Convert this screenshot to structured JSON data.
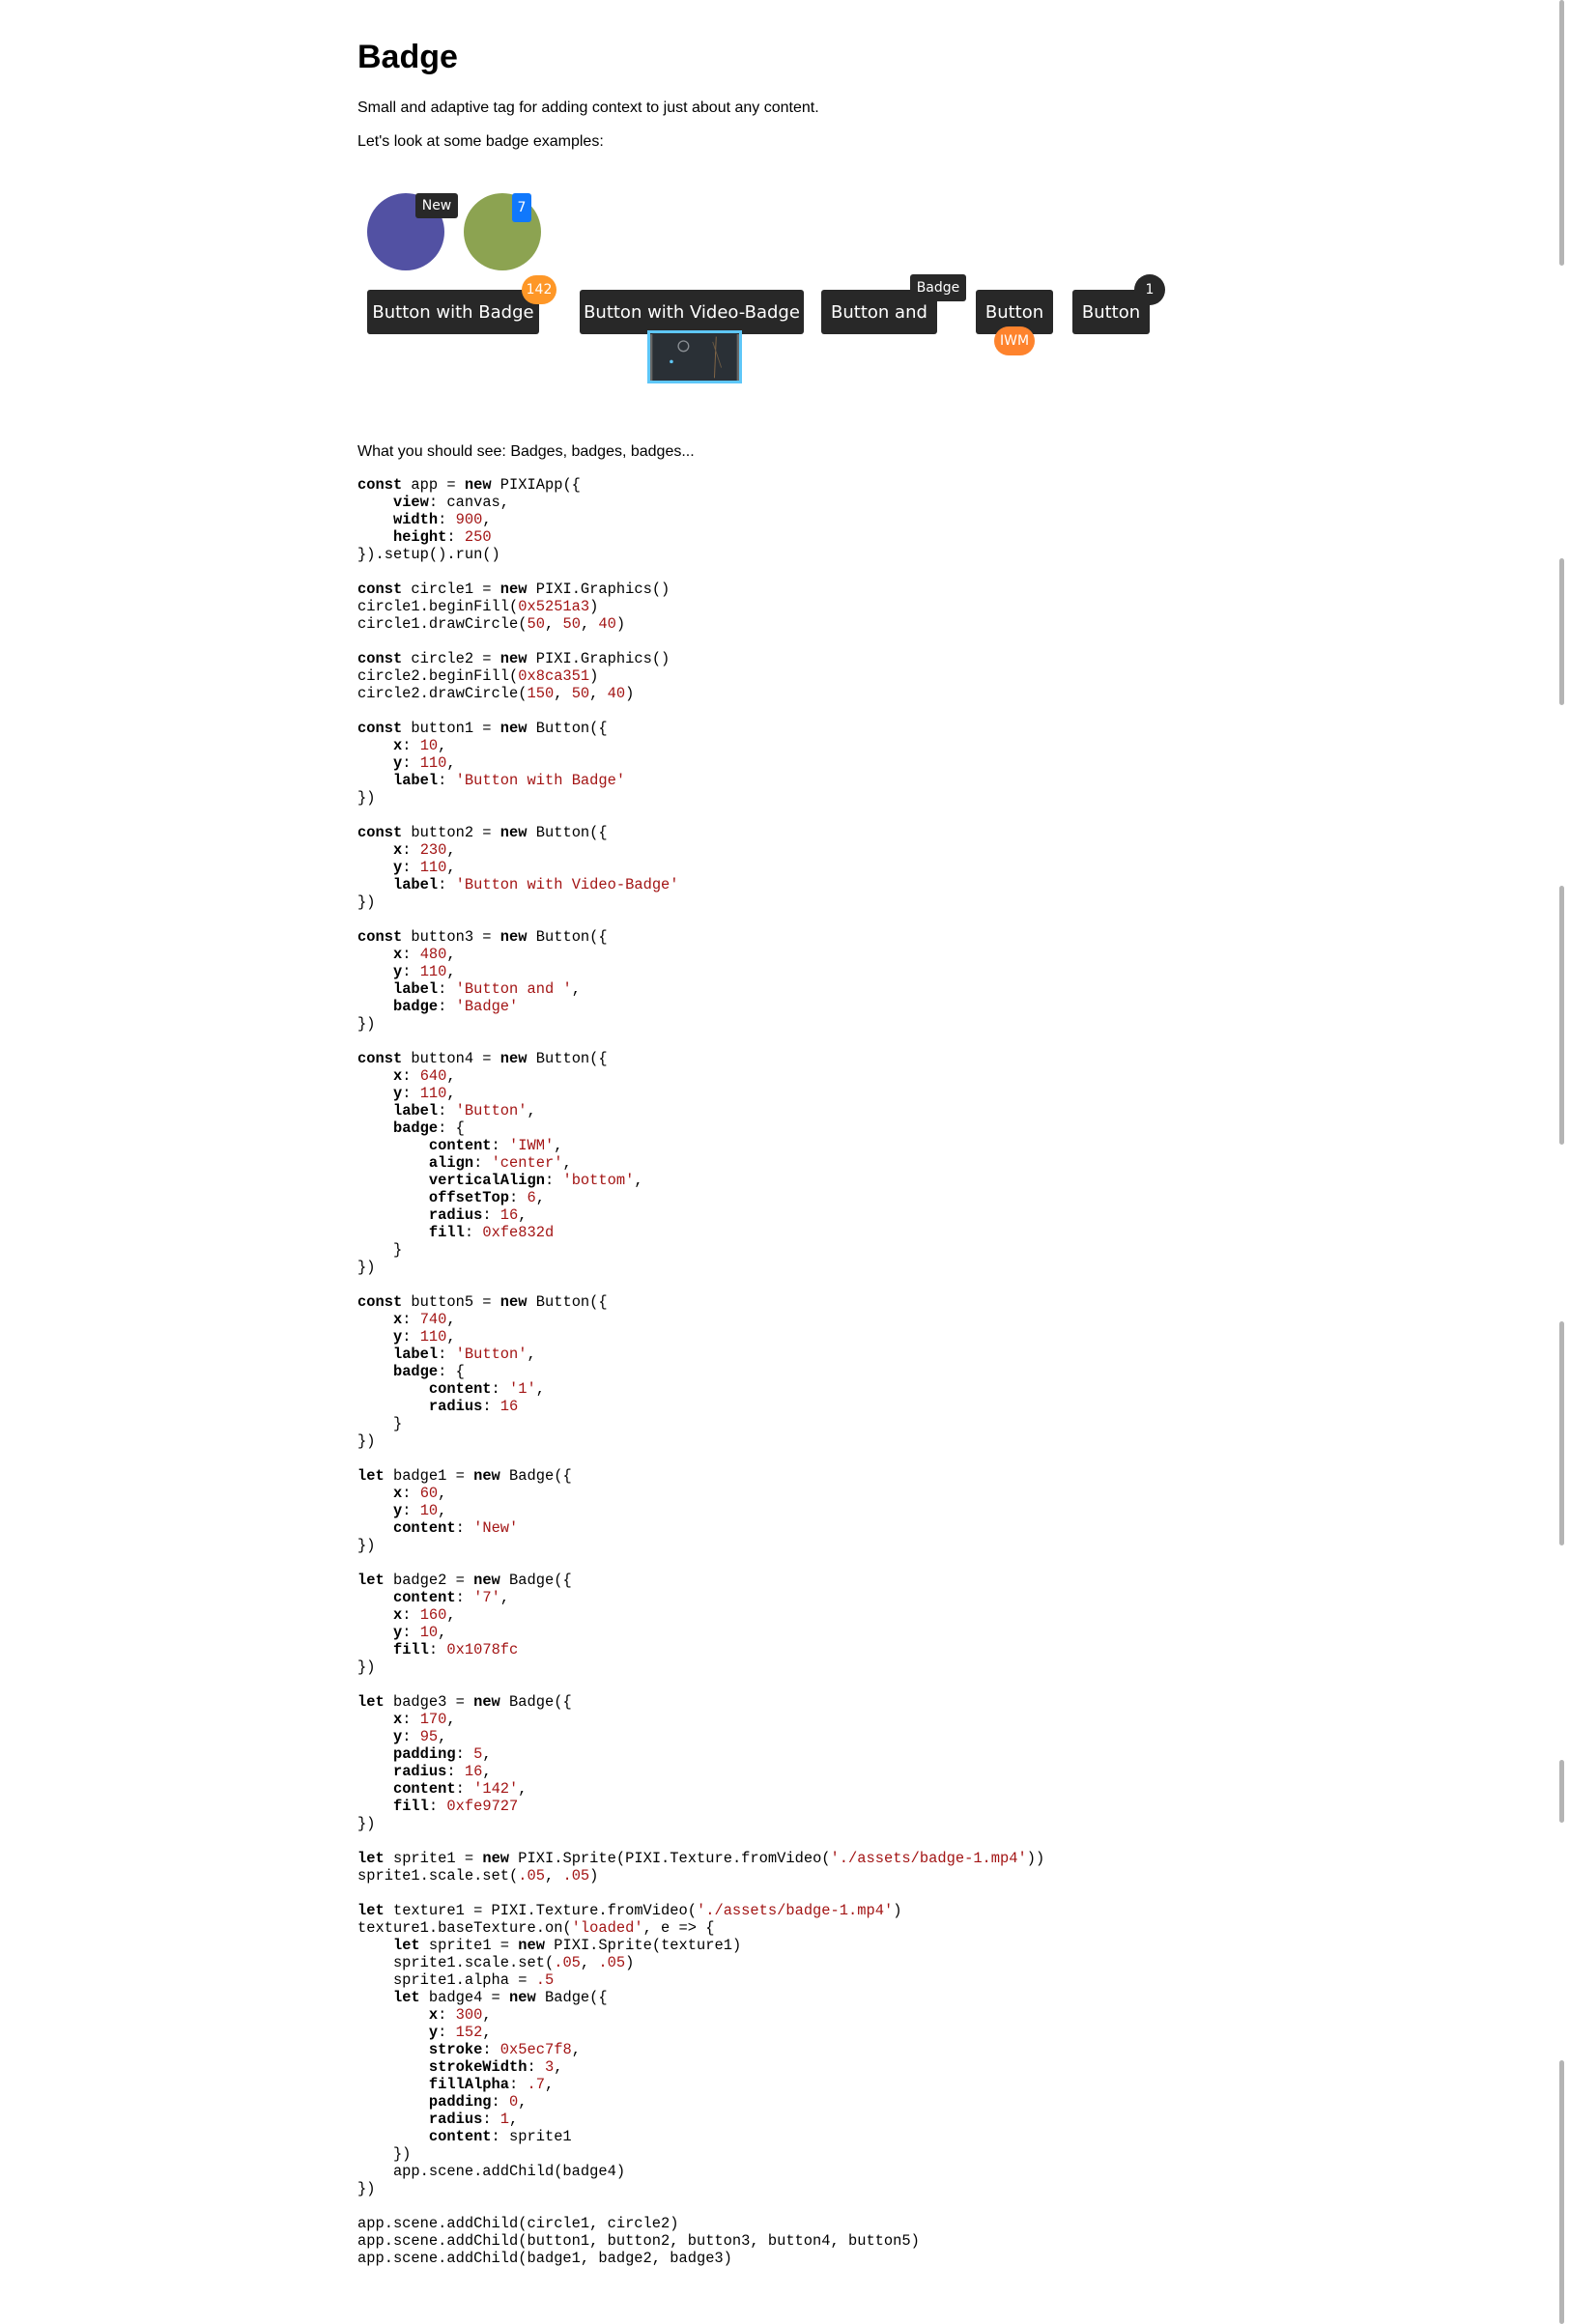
{
  "title": "Badge",
  "intro": "Small and adaptive tag for adding context to just about any content.",
  "lead": "Let's look at some badge examples:",
  "demo": {
    "circle1_color": "#5251a3",
    "circle2_color": "#8ca351",
    "badge1": {
      "content": "New",
      "fill": "#282828"
    },
    "badge2": {
      "content": "7",
      "fill": "#1078fc"
    },
    "badge3": {
      "content": "142",
      "fill": "#fe9727"
    },
    "button1": {
      "label": "Button with Badge"
    },
    "button2": {
      "label": "Button with Video-Badge"
    },
    "button3": {
      "label": "Button and ",
      "badge": "Badge"
    },
    "button4": {
      "label": "Button",
      "badge": "IWM",
      "badge_fill": "#fe832d"
    },
    "button5": {
      "label": "Button",
      "badge": "1"
    },
    "video_badge_stroke": "#5ec7f8"
  },
  "expected": "What you should see: Badges, badges, badges...",
  "code_lines": [
    "const app = new PIXIApp({",
    "    view: canvas,",
    "    width: 900,",
    "    height: 250",
    "}).setup().run()",
    "",
    "const circle1 = new PIXI.Graphics()",
    "circle1.beginFill(0x5251a3)",
    "circle1.drawCircle(50, 50, 40)",
    "",
    "const circle2 = new PIXI.Graphics()",
    "circle2.beginFill(0x8ca351)",
    "circle2.drawCircle(150, 50, 40)",
    "",
    "const button1 = new Button({",
    "    x: 10,",
    "    y: 110,",
    "    label: 'Button with Badge'",
    "})",
    "",
    "const button2 = new Button({",
    "    x: 230,",
    "    y: 110,",
    "    label: 'Button with Video-Badge'",
    "})",
    "",
    "const button3 = new Button({",
    "    x: 480,",
    "    y: 110,",
    "    label: 'Button and ',",
    "    badge: 'Badge'",
    "})",
    "",
    "const button4 = new Button({",
    "    x: 640,",
    "    y: 110,",
    "    label: 'Button',",
    "    badge: {",
    "        content: 'IWM',",
    "        align: 'center',",
    "        verticalAlign: 'bottom',",
    "        offsetTop: 6,",
    "        radius: 16,",
    "        fill: 0xfe832d",
    "    }",
    "})",
    "",
    "const button5 = new Button({",
    "    x: 740,",
    "    y: 110,",
    "    label: 'Button',",
    "    badge: {",
    "        content: '1',",
    "        radius: 16",
    "    }",
    "})",
    "",
    "let badge1 = new Badge({",
    "    x: 60,",
    "    y: 10,",
    "    content: 'New'",
    "})",
    "",
    "let badge2 = new Badge({",
    "    content: '7',",
    "    x: 160,",
    "    y: 10,",
    "    fill: 0x1078fc",
    "})",
    "",
    "let badge3 = new Badge({",
    "    x: 170,",
    "    y: 95,",
    "    padding: 5,",
    "    radius: 16,",
    "    content: '142',",
    "    fill: 0xfe9727",
    "})",
    "",
    "let sprite1 = new PIXI.Sprite(PIXI.Texture.fromVideo('./assets/badge-1.mp4'))",
    "sprite1.scale.set(.05, .05)",
    "",
    "let texture1 = PIXI.Texture.fromVideo('./assets/badge-1.mp4')",
    "texture1.baseTexture.on('loaded', e => {",
    "    let sprite1 = new PIXI.Sprite(texture1)",
    "    sprite1.scale.set(.05, .05)",
    "    sprite1.alpha = .5",
    "    let badge4 = new Badge({",
    "        x: 300,",
    "        y: 152,",
    "        stroke: 0x5ec7f8,",
    "        strokeWidth: 3,",
    "        fillAlpha: .7,",
    "        padding: 0,",
    "        radius: 1,",
    "        content: sprite1",
    "    })",
    "    app.scene.addChild(badge4)",
    "})",
    "",
    "app.scene.addChild(circle1, circle2)",
    "app.scene.addChild(button1, button2, button3, button4, button5)",
    "app.scene.addChild(badge1, badge2, badge3)"
  ]
}
